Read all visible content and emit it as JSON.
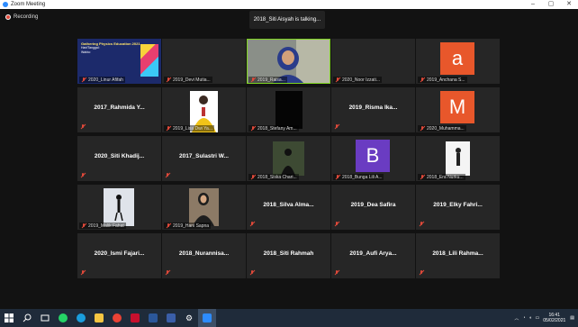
{
  "window": {
    "title": "Zoom Meeting",
    "controls": [
      "–",
      "▢",
      "✕"
    ]
  },
  "recording_label": "Recording",
  "talking_label": "2018_Siti Aisyah is talking...",
  "tiles": [
    {
      "name": "2020_Linur Afifah",
      "kind": "photo",
      "photo": "slide"
    },
    {
      "name": "2019_Devi Mutia...",
      "kind": "blank"
    },
    {
      "name": "2019_Raisa...",
      "kind": "photo",
      "photo": "hijab-blue",
      "active": true
    },
    {
      "name": "2020_Noor Izzati...",
      "kind": "blank"
    },
    {
      "name": "2019_Anchana S...",
      "kind": "letter",
      "letter": "a",
      "color": "#e8572b"
    },
    {
      "name": "2017_Rahmida Y...",
      "kind": "name"
    },
    {
      "name": "2019_Lisa Dwi Ya...",
      "kind": "photo",
      "photo": "yellow"
    },
    {
      "name": "2018_Stefany Am...",
      "kind": "photo",
      "photo": "dark"
    },
    {
      "name": "2019_Risma Ika...",
      "kind": "name"
    },
    {
      "name": "2020_Muhamma...",
      "kind": "letter",
      "letter": "M",
      "color": "#e8572b"
    },
    {
      "name": "2020_Siti Khadij...",
      "kind": "name"
    },
    {
      "name": "2017_Sulastri W...",
      "kind": "name"
    },
    {
      "name": "2018_Siska Chari...",
      "kind": "photo",
      "photo": "outdoor"
    },
    {
      "name": "2018_Bunga Lili A...",
      "kind": "letter",
      "letter": "B",
      "color": "#6a3cc2"
    },
    {
      "name": "2018_Era Nurku...",
      "kind": "photo",
      "photo": "white-standing"
    },
    {
      "name": "2019_Malik Fahat",
      "kind": "photo",
      "photo": "sky"
    },
    {
      "name": "2019_Hani Sapna",
      "kind": "photo",
      "photo": "hijab-dark"
    },
    {
      "name": "2018_Silva Alma...",
      "kind": "name"
    },
    {
      "name": "2019_Dea Safira",
      "kind": "name"
    },
    {
      "name": "2019_Elky Fahri...",
      "kind": "name"
    },
    {
      "name": "2020_Ismi Fajari...",
      "kind": "name"
    },
    {
      "name": "2018_Nurannisa...",
      "kind": "name"
    },
    {
      "name": "2018_Siti Rahmah",
      "kind": "name"
    },
    {
      "name": "2019_Aufi Arya...",
      "kind": "name"
    },
    {
      "name": "2018_Lili Rahma...",
      "kind": "name"
    }
  ],
  "slide": {
    "title": "Gathering Physics Education 2021",
    "lines": [
      "Hari/Tanggal:",
      "Waktu:"
    ]
  },
  "clock": {
    "time": "16:41",
    "date": "05/02/2021"
  }
}
